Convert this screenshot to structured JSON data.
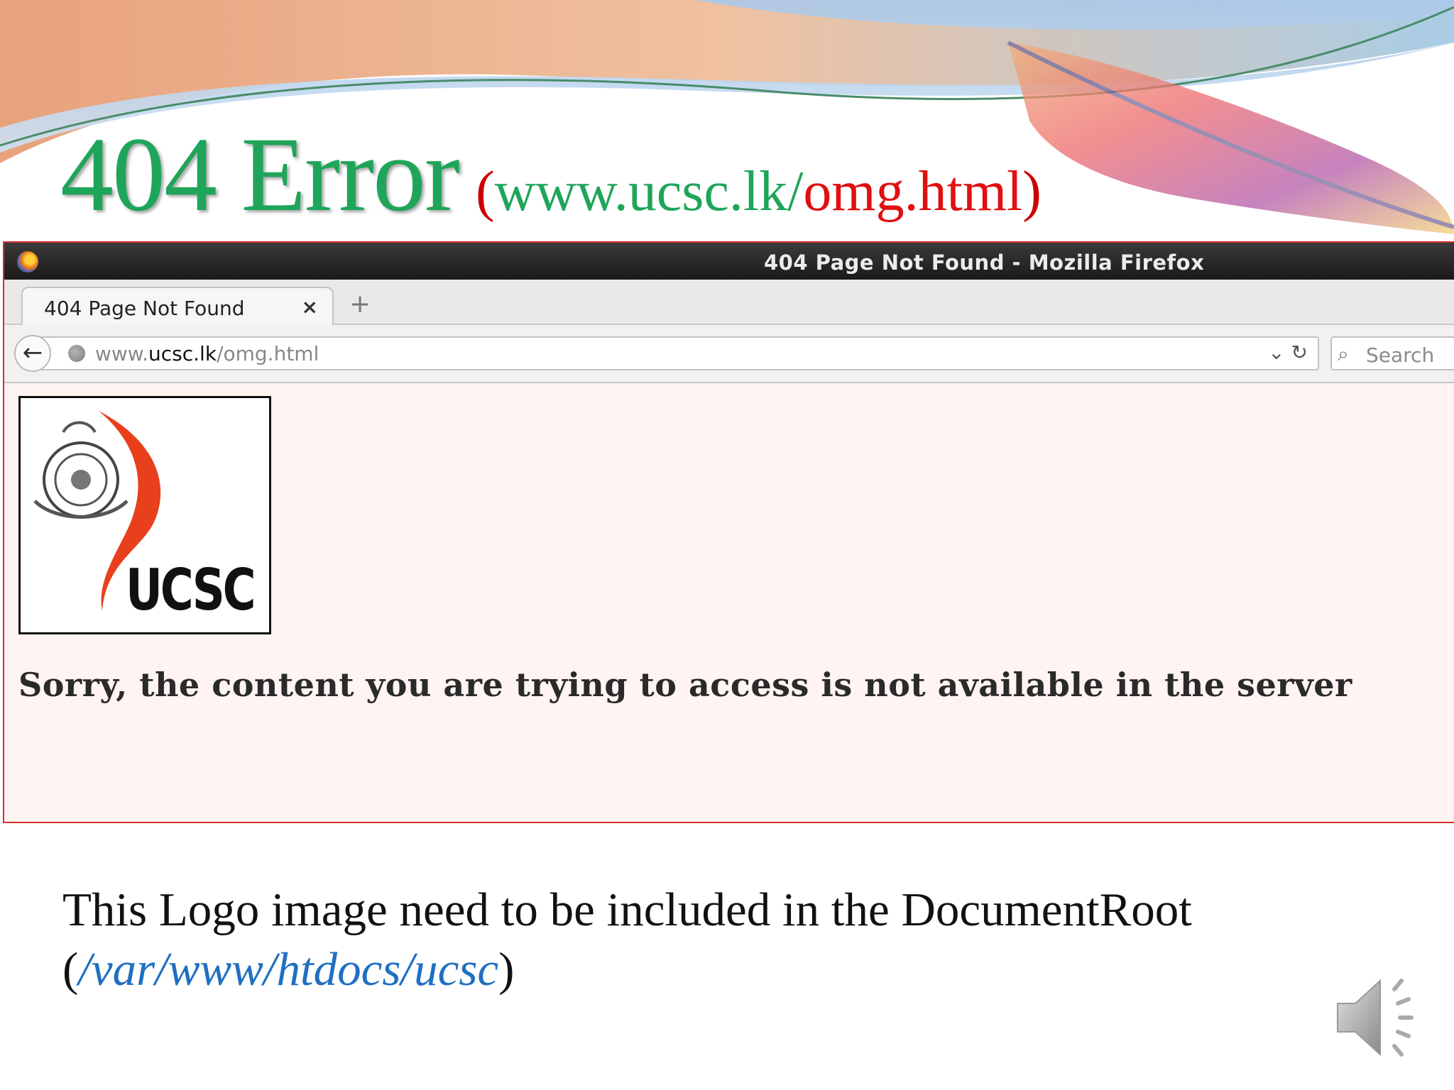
{
  "slide": {
    "title_main": "404 Error",
    "title_paren_open": "(",
    "title_host": "www.ucsc.lk/",
    "title_page": "omg.html",
    "title_paren_close": ")",
    "note_line1": "This Logo image need to be included in the DocumentRoot",
    "note_paren_open": "(",
    "note_path": "/var/www/htdocs/ucsc",
    "note_paren_close": ")"
  },
  "browser": {
    "window_title": "404 Page Not Found - Mozilla Firefox",
    "tab_label": "404 Page Not Found",
    "tab_close": "×",
    "new_tab": "+",
    "back_glyph": "←",
    "url_prefix": "www.",
    "url_host": "ucsc.lk",
    "url_path": "/omg.html",
    "url_tools": "⌄ ↻",
    "search_glyph": "🔍",
    "search_placeholder": "Search"
  },
  "page": {
    "logo_text": "UCSC",
    "message": "Sorry, the content you are trying to access is not available in the server"
  },
  "icons": {
    "browser": "firefox-icon",
    "url": "globe-icon",
    "search": "search-icon",
    "audio": "speaker-icon"
  },
  "colors": {
    "title_green": "#1fa55a",
    "title_red": "#e01010",
    "path_blue": "#1f6fc2",
    "page_bg": "#fff4f1",
    "logo_red": "#e8401c"
  }
}
